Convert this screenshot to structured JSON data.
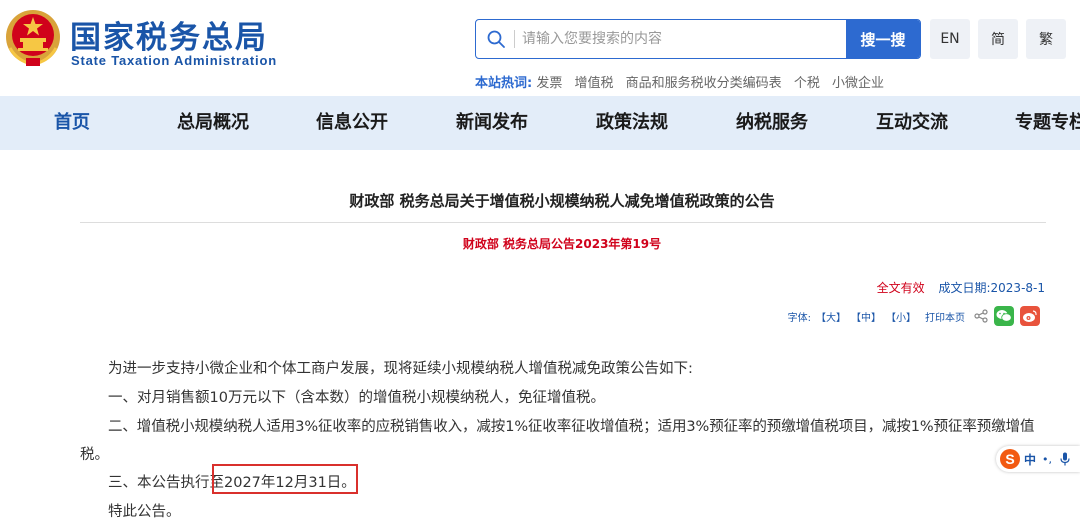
{
  "header": {
    "logo_cn": "国家税务总局",
    "logo_en": "State Taxation Administration",
    "search": {
      "placeholder": "请输入您要搜索的内容",
      "button_label": "搜一搜"
    },
    "lang_buttons": [
      "EN",
      "简",
      "繁"
    ],
    "hot_label": "本站热词:",
    "hot_keywords": [
      "发票",
      "增值税",
      "商品和服务税收分类编码表",
      "个税",
      "小微企业"
    ]
  },
  "nav": {
    "items": [
      "首页",
      "总局概况",
      "信息公开",
      "新闻发布",
      "政策法规",
      "纳税服务",
      "互动交流",
      "专题专栏"
    ],
    "active": "首页"
  },
  "article": {
    "title": "财政部 税务总局关于增值税小规模纳税人减免增值税政策的公告",
    "doc_number": "财政部 税务总局公告2023年第19号",
    "status": "全文有效",
    "date": "成文日期:2023-8-1",
    "tools": {
      "font_label": "字体:",
      "large": "【大】",
      "medium": "【中】",
      "small": "【小】",
      "print": "打印本页"
    },
    "paragraphs": [
      "为进一步支持小微企业和个体工商户发展，现将延续小规模纳税人增值税减免政策公告如下:",
      "一、对月销售额10万元以下（含本数）的增值税小规模纳税人，免征增值税。",
      "二、增值税小规模纳税人适用3%征收率的应税销售收入，减按1%征收率征收增值税；适用3%预征率的预缴增值税项目，减按1%预征率预缴增值",
      "税。",
      "三、本公告执行至2027年12月31日。",
      "特此公告。"
    ]
  },
  "ime": {
    "mode": "中",
    "punct": "•,"
  },
  "colors": {
    "brand_blue": "#1a55a8",
    "button_blue": "#2d6ad0",
    "nav_bg": "#e3edf9",
    "red": "#d0021b"
  }
}
